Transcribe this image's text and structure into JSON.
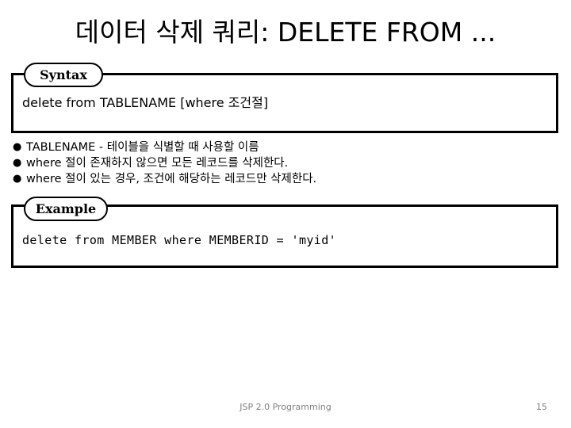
{
  "slide": {
    "title": "데이터 삭제 쿼리: DELETE FROM ...",
    "background_color": "#ffffff",
    "text_color": "#000000"
  },
  "syntax_section": {
    "tab_label": "Syntax",
    "code": "delete from TABLENAME [where 조건절]"
  },
  "notes": {
    "bullet_glyph": "●",
    "items": [
      "TABLENAME - 테이블을 식별할 때 사용할 이름",
      "where 절이 존재하지 않으면 모든 레코드를 삭제한다.",
      "where 절이 있는 경우, 조건에 해당하는 레코드만 삭제한다."
    ]
  },
  "example_section": {
    "tab_label": "Example",
    "code": "delete from MEMBER where MEMBERID = 'myid'"
  },
  "footer": {
    "course": "JSP 2.0 Programming",
    "page_number": "15",
    "color": "#808080"
  }
}
